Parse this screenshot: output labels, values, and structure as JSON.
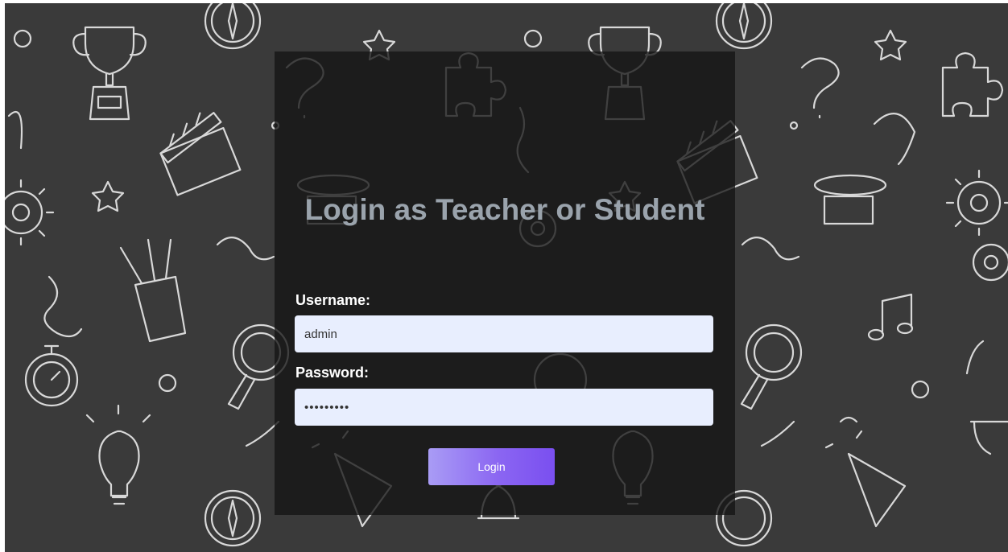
{
  "login": {
    "title": "Login as Teacher or Student",
    "username_label": "Username:",
    "username_value": "admin",
    "password_label": "Password:",
    "password_value": "*********",
    "login_button": "Login"
  },
  "colors": {
    "background": "#3a3a3a",
    "panel": "#141414",
    "title": "#9aa3ac",
    "input_bg": "#e8eefe",
    "button_start": "#a99cf5",
    "button_end": "#7a4ff0"
  },
  "background_doodles": [
    "trophy-icon",
    "star-icon",
    "compass-icon",
    "puzzle-icon",
    "question-mark-icon",
    "clapperboard-icon",
    "gear-icon",
    "pencil-cup-icon",
    "magnifier-icon",
    "stopwatch-icon",
    "lightbulb-icon",
    "party-popper-icon",
    "hourglass-icon",
    "music-note-icon",
    "ribbon-icon",
    "circle-icon"
  ]
}
